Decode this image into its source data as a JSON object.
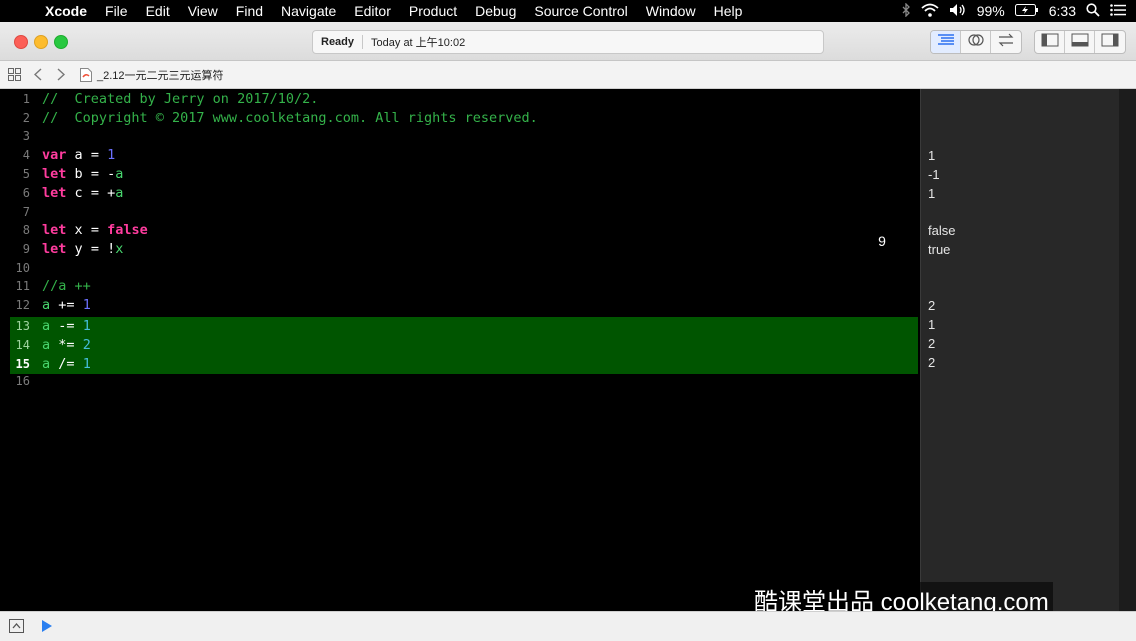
{
  "menubar": {
    "items": [
      "Xcode",
      "File",
      "Edit",
      "View",
      "Find",
      "Navigate",
      "Editor",
      "Product",
      "Debug",
      "Source Control",
      "Window",
      "Help"
    ],
    "battery": "99%",
    "time": "6:33"
  },
  "toolbar": {
    "status": "Ready",
    "timestamp": "Today at 上午10:02"
  },
  "jumpbar": {
    "filename": "_2.12一元二元三元运算符"
  },
  "editor": {
    "line_numbers": [
      "1",
      "2",
      "3",
      "4",
      "5",
      "6",
      "7",
      "8",
      "9",
      "10",
      "11",
      "12",
      "13",
      "14",
      "15",
      "16"
    ],
    "lines": [
      "//  Created by Jerry on 2017/10/2.",
      "//  Copyright © 2017 www.coolketang.com. All rights reserved.",
      "",
      "var a = 1",
      "let b = -a",
      "let c = +a",
      "",
      "let x = false",
      "let y = !x",
      "",
      "//a ++",
      "a += 1",
      "a -= 1",
      "a *= 2",
      "a /= 1",
      ""
    ],
    "execution_badge": "9"
  },
  "results": {
    "values": [
      "",
      "",
      "",
      "1",
      "-1",
      "1",
      "",
      "false",
      "true",
      "",
      "",
      "2",
      "1",
      "2",
      "2",
      ""
    ]
  },
  "watermark": "酷课堂出品 coolketang.com",
  "colors": {
    "keyword": "#ff3c9e",
    "comment": "#34b24a",
    "number": "#6c71ff",
    "highlight": "#005500"
  }
}
